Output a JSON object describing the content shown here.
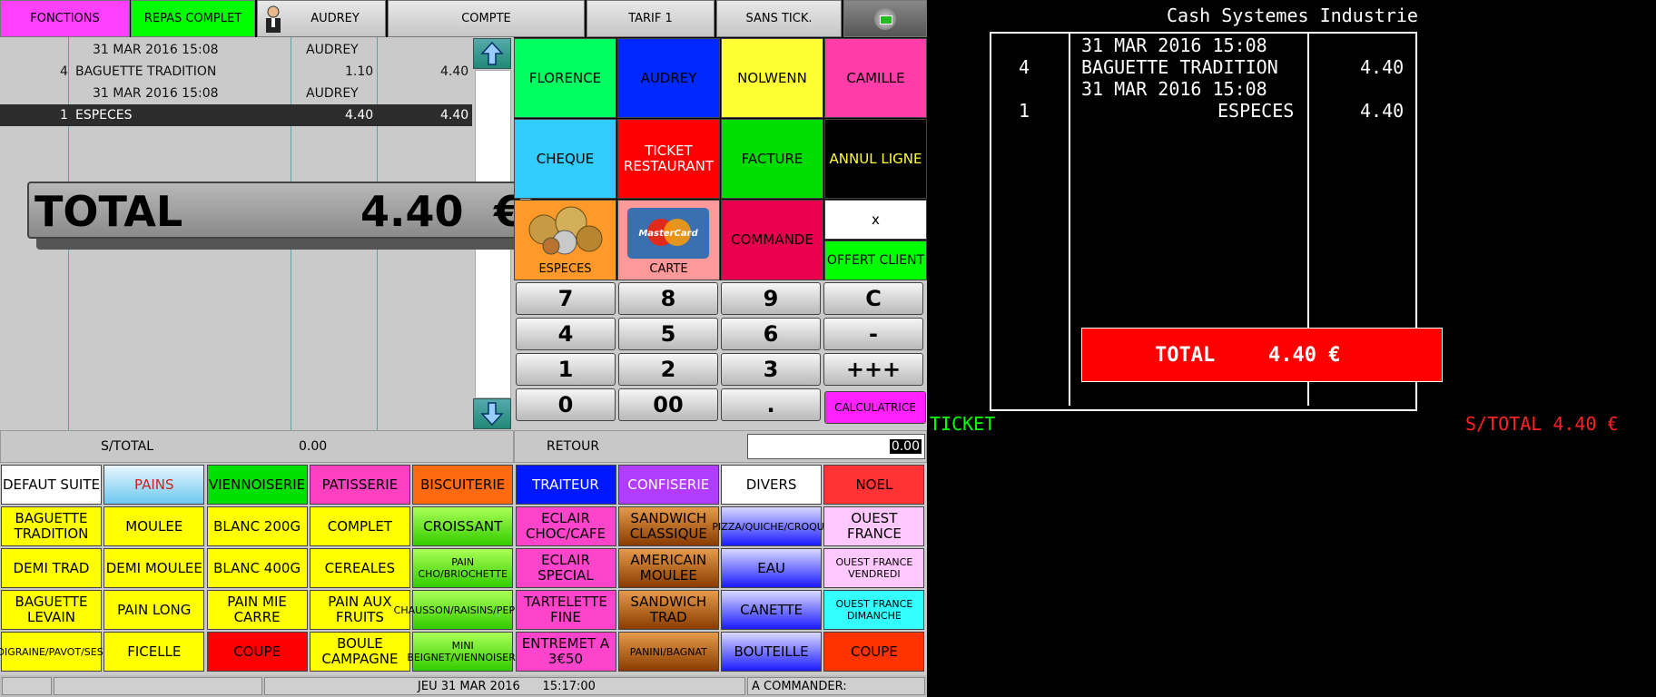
{
  "topbar": {
    "fonctions": "FONCTIONS",
    "repas_complet": "REPAS COMPLET",
    "user": "AUDREY",
    "compte": "COMPTE",
    "tarif": "TARIF 1",
    "sans_tick": "SANS TICK."
  },
  "ticket_lines": [
    {
      "qty": "",
      "label": "31 MAR 2016 15:08",
      "seller": "AUDREY",
      "price": "",
      "amount": ""
    },
    {
      "qty": "4",
      "label": "BAGUETTE TRADITION",
      "seller": "",
      "price": "1.10",
      "amount": "4.40"
    },
    {
      "qty": "",
      "label": "31 MAR 2016 15:08",
      "seller": "AUDREY",
      "price": "",
      "amount": ""
    },
    {
      "qty": "1",
      "label": "ESPECES",
      "seller": "",
      "price": "4.40",
      "amount": "4.40"
    }
  ],
  "total": {
    "label": "TOTAL",
    "value": "4.40",
    "currency": "€"
  },
  "subtotal": {
    "label": "S/TOTAL",
    "value": "0.00"
  },
  "retour": {
    "label": "RETOUR",
    "value": "0.00"
  },
  "sellers": [
    "FLORENCE",
    "AUDREY",
    "NOLWENN",
    "CAMILLE"
  ],
  "payments": {
    "cheque": "CHEQUE",
    "ticket_restaurant": "TICKET RESTAURANT",
    "facture": "FACTURE",
    "annul_ligne": "ANNUL LIGNE",
    "especes": "ESPECES",
    "carte": "CARTE",
    "card_brand": "MasterCard",
    "commande": "COMMANDE",
    "x": "x",
    "offert_client": "OFFERT CLIENT"
  },
  "numpad": {
    "keys": [
      "7",
      "8",
      "9",
      "C",
      "4",
      "5",
      "6",
      "-",
      "1",
      "2",
      "3",
      "+++",
      "0",
      "00",
      "."
    ],
    "calculatrice": "CALCULATRICE"
  },
  "categories": [
    "DEFAUT SUITE",
    "PAINS",
    "VIENNOISERIE",
    "PATISSERIE",
    "BISCUITERIE",
    "TRAITEUR",
    "CONFISERIE",
    "DIVERS",
    "NOEL"
  ],
  "products": [
    [
      "BAGUETTE TRADITION",
      "MOULEE",
      "BLANC 200G",
      "COMPLET",
      "CROISSANT",
      "ECLAIR CHOC/CAFE",
      "SANDWICH CLASSIQUE",
      "PIZZA/QUICHE/CROQUE",
      "OUEST FRANCE"
    ],
    [
      "DEMI TRAD",
      "DEMI MOULEE",
      "BLANC 400G",
      "CEREALES",
      "PAIN CHO/BRIOCHETTE",
      "ECLAIR SPECIAL",
      "AMERICAIN MOULEE",
      "EAU",
      "OUEST FRANCE VENDREDI"
    ],
    [
      "BAGUETTE LEVAIN",
      "PAIN LONG",
      "PAIN MIE CARRE",
      "PAIN AUX FRUITS",
      "CHAUSSON/RAISINS/PEPITO",
      "TARTELETTE FINE",
      "SANDWICH TRAD",
      "CANETTE",
      "OUEST FRANCE DIMANCHE"
    ],
    [
      "TRADIGRAINE/PAVOT/SESAME",
      "FICELLE",
      "COUPE",
      "BOULE CAMPAGNE",
      "MINI BEIGNET/VIENNOISERI",
      "ENTREMET A 3€50",
      "PANINI/BAGNAT",
      "BOUTEILLE",
      "COUPE"
    ]
  ],
  "statusbar": {
    "datetime": "JEU 31 MAR 2016      15:17:00",
    "commander": "A COMMANDER:"
  },
  "customer_display": {
    "company": "Cash Systemes Industrie",
    "lines": [
      {
        "qty": "",
        "label": "31 MAR 2016 15:08",
        "amount": ""
      },
      {
        "qty": "4",
        "label": "BAGUETTE TRADITION",
        "amount": "4.40"
      },
      {
        "qty": "",
        "label": "31 MAR 2016 15:08",
        "amount": ""
      },
      {
        "qty": "1",
        "label": "ESPECES",
        "amount": "4.40"
      }
    ],
    "total_label": "TOTAL",
    "total_value": "4.40 €",
    "ticket": "TICKET",
    "stotal": "S/TOTAL 4.40 €"
  },
  "colors": {
    "magenta": "#ff40ff",
    "green": "#00ff55",
    "blue": "#0022ff",
    "yellow": "#ffff33",
    "pink": "#ff3ca8",
    "cyan": "#33ccff",
    "red": "#ff0000"
  }
}
